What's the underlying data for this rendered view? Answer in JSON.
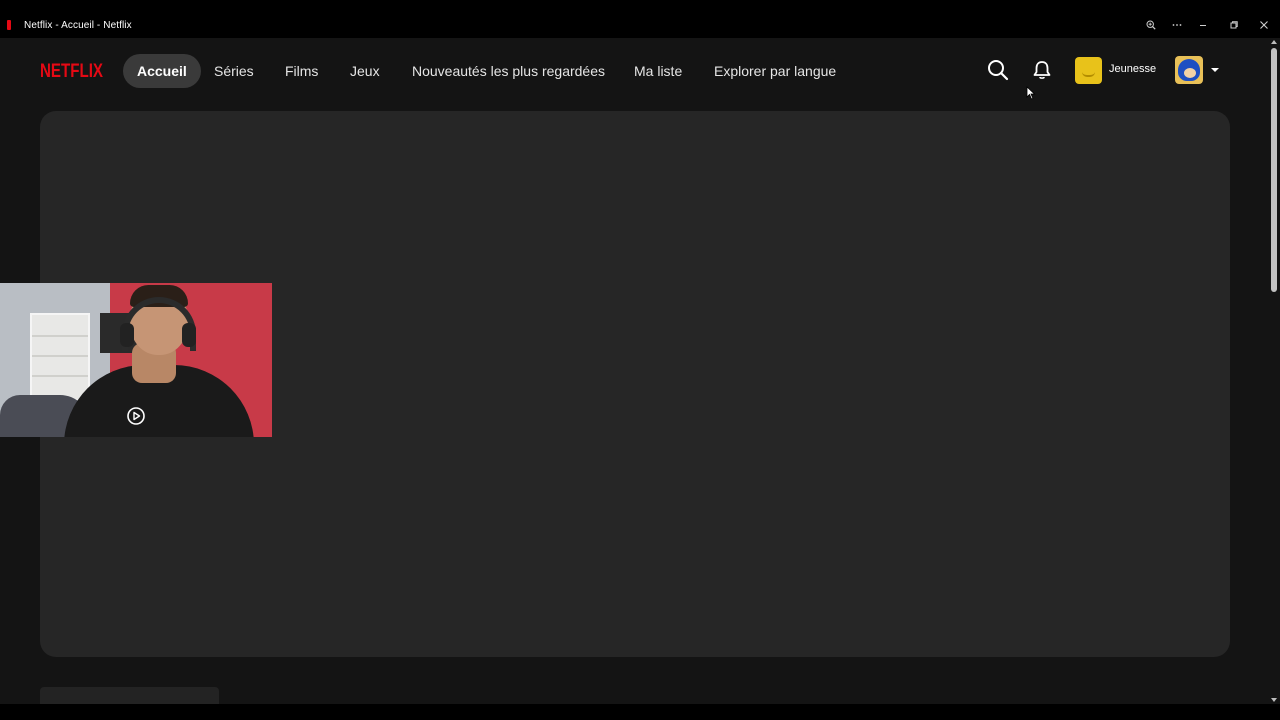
{
  "window": {
    "title": "Netflix - Accueil - Netflix",
    "controls": [
      "zoom-icon",
      "more-icon",
      "minimize-icon",
      "restore-icon",
      "close-icon"
    ]
  },
  "header": {
    "logo": "NETFLIX",
    "nav": [
      {
        "label": "Accueil",
        "active": true
      },
      {
        "label": "Séries"
      },
      {
        "label": "Films"
      },
      {
        "label": "Jeux"
      },
      {
        "label": "Nouveautés les plus regardées"
      },
      {
        "label": "Ma liste"
      },
      {
        "label": "Explorer par langue"
      }
    ],
    "icons": [
      "search-icon",
      "bell-icon"
    ],
    "kids_label": "Jeunesse"
  },
  "colors": {
    "brand": "#e50914",
    "background": "#141414",
    "placeholder": "#262626",
    "active_pill": "#3a3a3a"
  }
}
